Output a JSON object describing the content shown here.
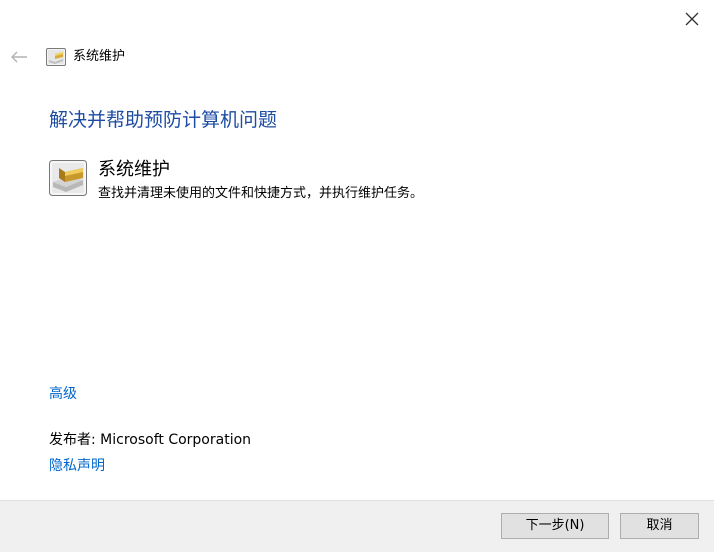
{
  "window": {
    "close_icon": "close-icon",
    "back_icon": "back-arrow-icon"
  },
  "header": {
    "title": "系统维护",
    "icon": "system-maintenance-icon"
  },
  "main": {
    "heading": "解决并帮助预防计算机问题",
    "task": {
      "title": "系统维护",
      "description": "查找并清理未使用的文件和快捷方式，并执行维护任务。",
      "icon": "system-maintenance-icon"
    },
    "advanced_link": "高级",
    "publisher": "发布者: Microsoft Corporation",
    "privacy_link": "隐私声明"
  },
  "footer": {
    "next_label": "下一步(N)",
    "cancel_label": "取消"
  },
  "colors": {
    "heading": "#1d4da3",
    "link": "#0066cc",
    "footer_bg": "#f0f0f0"
  }
}
